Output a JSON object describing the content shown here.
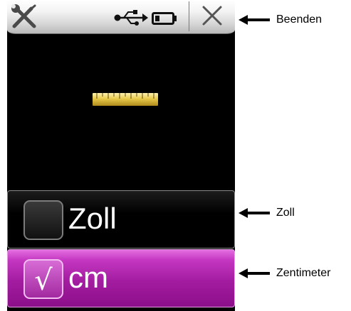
{
  "statusbar": {
    "tools_icon": "tools-icon",
    "usb_icon": "usb-icon",
    "battery_icon": "battery-icon",
    "close_icon": "close-icon"
  },
  "center_icon": "tape-measure-icon",
  "options": [
    {
      "label": "Zoll",
      "checked": false
    },
    {
      "label": "cm",
      "checked": true,
      "check_glyph": "√"
    }
  ],
  "annotations": {
    "beenden": "Beenden",
    "zoll": "Zoll",
    "zentimeter": "Zentimeter"
  },
  "colors": {
    "screen_background": "#000000",
    "selected_option": "#a31ca0",
    "topbar": "#e6e6e6",
    "tape_yellow": "#e8c94a"
  }
}
